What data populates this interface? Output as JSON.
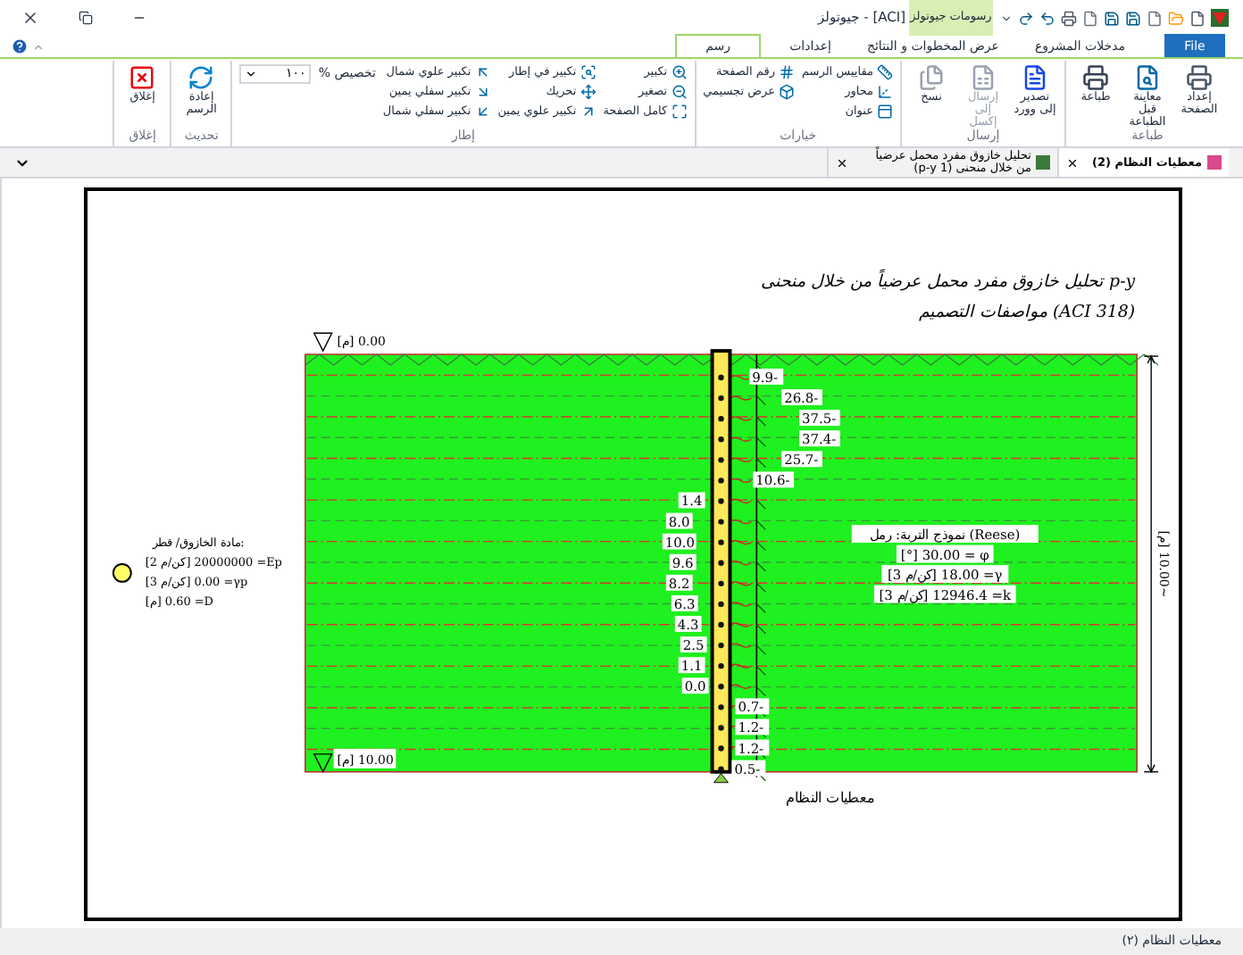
{
  "window": {
    "title": "جيوتولز - [ACI]",
    "contextual_tab": "رسومات جيوتولز"
  },
  "ribbon_tabs": [
    {
      "label": "File",
      "kind": "file",
      "selected": false
    },
    {
      "label": "مدخلات المشروع",
      "kind": "tab",
      "selected": false
    },
    {
      "label": "عرض المخطوات و النتائج",
      "kind": "tab",
      "selected": false
    },
    {
      "label": "إعدادات",
      "kind": "tab",
      "selected": false
    },
    {
      "label": "رسم",
      "kind": "tab",
      "selected": true
    }
  ],
  "ribbon_groups": [
    {
      "label": "طباعة",
      "kind": "large",
      "items": [
        {
          "label": "إعداد الصفحة",
          "disabled": false
        },
        {
          "label": "معاينة قبل الطباعة",
          "disabled": false
        },
        {
          "label": "طباعة",
          "disabled": false
        }
      ]
    },
    {
      "label": "إرسال",
      "kind": "large",
      "items": [
        {
          "label": "تصدير إلى وورد",
          "disabled": false
        },
        {
          "label": "إرسال إلى إكسل",
          "disabled": true
        },
        {
          "label": "نسخ",
          "disabled": false
        }
      ]
    },
    {
      "label": "خيارات",
      "kind": "small",
      "columns": [
        [
          {
            "label": "مقاييس الرسم"
          },
          {
            "label": "محاور"
          },
          {
            "label": "عنوان"
          }
        ],
        [
          {
            "label": "رقم الصفحة"
          },
          {
            "label": "عرض تجسيمي"
          }
        ]
      ]
    },
    {
      "label": "إطار",
      "kind": "small",
      "columns": [
        [
          {
            "label": "تكبير"
          },
          {
            "label": "تصغير"
          },
          {
            "label": "كامل الصفحة"
          }
        ],
        [
          {
            "label": "تكبير في إطار"
          },
          {
            "label": "تحريك"
          },
          {
            "label": "تكبير علوي يمين"
          }
        ],
        [
          {
            "label": "تكبير علوي شمال"
          },
          {
            "label": "تكبير سفلي يمين"
          },
          {
            "label": "تكبير سفلي شمال"
          }
        ]
      ],
      "zoom": {
        "label": "تخصيص %",
        "value": "١٠٠"
      }
    },
    {
      "label": "تحديث",
      "kind": "large",
      "items": [
        {
          "label": "إعادة الرسم",
          "disabled": false
        }
      ]
    },
    {
      "label": "إغلاق",
      "kind": "large",
      "items": [
        {
          "label": "إغلاق",
          "disabled": false
        }
      ]
    }
  ],
  "doc_tabs": [
    {
      "label": "معطيات النظام (2)",
      "selected": true
    },
    {
      "label": "تحليل خازوق مفرد محمل عرضياً من خلال منحنى (1 p-y)",
      "selected": false
    }
  ],
  "drawing": {
    "title": "تحليل خازوق مفرد محمل عرضياً من خلال منحنى p-y",
    "subtitle": "مواصفات التصميم (ACI 318)",
    "pile_material": {
      "heading": "مادة الخازوق/ قطر:",
      "lines": [
        "[كن/م 2] 20000000 =Ep",
        "[كن/م 3] 0.00 =γp",
        "[م] 0.60 =D"
      ]
    },
    "soil": [
      "نموذج التربة: رمل (Reese)",
      "[°] 30.00 = φ",
      "[كن/م 3] 18.00 =γ",
      "[كن/م 3] 12946.4 =k"
    ],
    "top_level": "[م] 0.00",
    "bottom_level": "[م] 10.00",
    "depth": "[م] 10.00~",
    "forces": [
      {
        "value": "9.9-",
        "kind": "right"
      },
      {
        "value": "26.8-",
        "kind": "right"
      },
      {
        "value": "37.5-",
        "kind": "right"
      },
      {
        "value": "37.4-",
        "kind": "right"
      },
      {
        "value": "25.7-",
        "kind": "right"
      },
      {
        "value": "10.6-",
        "kind": "right"
      },
      {
        "value": "1.4",
        "kind": "left"
      },
      {
        "value": "8.0",
        "kind": "left"
      },
      {
        "value": "10.0",
        "kind": "left"
      },
      {
        "value": "9.6",
        "kind": "left"
      },
      {
        "value": "8.2",
        "kind": "left"
      },
      {
        "value": "6.3",
        "kind": "left"
      },
      {
        "value": "4.3",
        "kind": "left"
      },
      {
        "value": "2.5",
        "kind": "left"
      },
      {
        "value": "1.1",
        "kind": "left"
      },
      {
        "value": "0.0",
        "kind": "left"
      },
      {
        "value": "0.7-",
        "kind": "right"
      },
      {
        "value": "1.2-",
        "kind": "right"
      },
      {
        "value": "1.2-",
        "kind": "right"
      },
      {
        "value": "0.5-",
        "kind": "right"
      }
    ],
    "caption": "معطيات النظام"
  },
  "status_bar": "معطيات النظام (٢)"
}
